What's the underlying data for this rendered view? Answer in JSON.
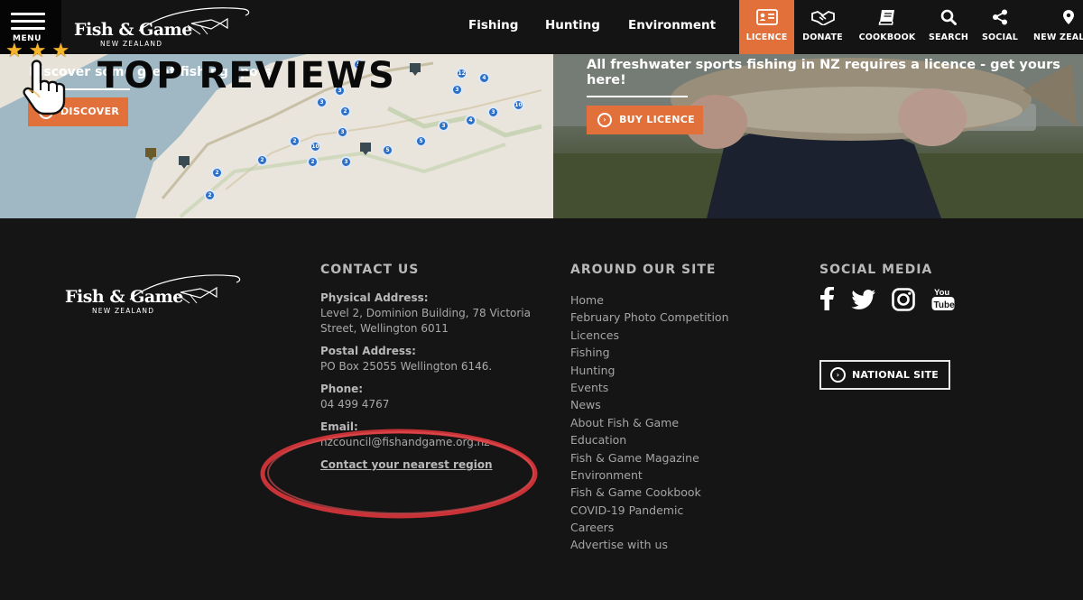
{
  "nav": {
    "menu_label": "MENU",
    "logo_brand": "Fish & Game",
    "logo_sub": "NEW ZEALAND",
    "primary": [
      "Fishing",
      "Hunting",
      "Environment"
    ],
    "utility": [
      {
        "label": "LICENCE",
        "icon": "id-card-icon",
        "active": true
      },
      {
        "label": "DONATE",
        "icon": "handshake-icon",
        "active": false
      },
      {
        "label": "COOKBOOK",
        "icon": "book-icon",
        "active": false
      },
      {
        "label": "SEARCH",
        "icon": "search-icon",
        "active": false
      },
      {
        "label": "SOCIAL",
        "icon": "share-icon",
        "active": false
      },
      {
        "label": "NEW ZEAL",
        "icon": "map-pin-icon",
        "active": false
      }
    ]
  },
  "hero": {
    "map_heading": "Discover some great fishing spots",
    "discover_label": "DISCOVER",
    "photo_heading": "All freshwater sports fishing in NZ requires a licence - get yours here!",
    "buy_label": "BUY LICENCE",
    "map_pins": [
      "12",
      "4",
      "3",
      "2",
      "3",
      "5",
      "3",
      "3",
      "4",
      "3",
      "2",
      "10",
      "2",
      "2",
      "3",
      "5",
      "3",
      "5",
      "2",
      "2",
      "3",
      "5",
      "10"
    ]
  },
  "overlay": {
    "title": "TOP REVIEWS",
    "stars": "★★★"
  },
  "footer": {
    "logo_brand": "Fish & Game",
    "logo_sub": "NEW ZEALAND",
    "contact_heading": "CONTACT US",
    "physical_label": "Physical Address:",
    "physical_value": "Level 2, Dominion Building, 78 Victoria Street, Wellington 6011",
    "postal_label": "Postal Address:",
    "postal_value": "PO Box 25055 Wellington 6146.",
    "phone_label": "Phone:",
    "phone_value": "04 499 4767",
    "email_label": "Email:",
    "email_value": "nzcouncil@fishandgame.org.nz",
    "contact_link": "Contact your nearest region",
    "site_heading": "AROUND OUR SITE",
    "site_links": [
      "Home",
      "February Photo Competition",
      "Licences",
      "Fishing",
      "Hunting",
      "Events",
      "News",
      "About Fish & Game",
      "Education",
      "Fish & Game Magazine",
      "Environment",
      "Fish & Game Cookbook",
      "COVID-19 Pandemic",
      "Careers",
      "Advertise with us"
    ],
    "social_heading": "SOCIAL MEDIA",
    "social_icons": [
      "facebook-icon",
      "twitter-icon",
      "instagram-icon",
      "youtube-icon"
    ],
    "national_label": "NATIONAL SITE"
  },
  "colors": {
    "accent": "#e2703a",
    "background": "#151515",
    "highlight_ring": "#d9353a"
  }
}
